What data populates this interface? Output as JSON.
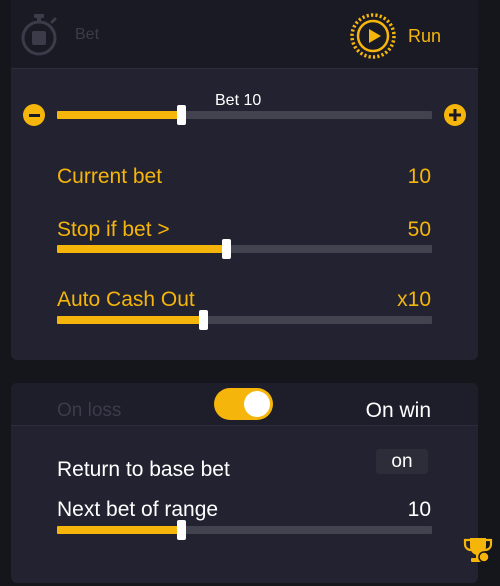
{
  "header": {
    "bet_tab_label": "Bet",
    "run_tab_label": "Run"
  },
  "bet_slider": {
    "label": "Bet 10",
    "value_fraction": 0.33
  },
  "current_bet": {
    "label": "Current bet",
    "value": "10"
  },
  "stop_if_bet": {
    "label": "Stop if bet >",
    "value": "50",
    "value_fraction": 0.45
  },
  "auto_cash_out": {
    "label": "Auto Cash Out",
    "value": "x10",
    "value_fraction": 0.39
  },
  "mode_toggle": {
    "left_label": "On loss",
    "right_label": "On win",
    "state": "on win"
  },
  "return_to_base": {
    "label": "Return to base bet",
    "value": "on"
  },
  "next_bet_range": {
    "label": "Next bet of range",
    "value": "10",
    "value_fraction": 0.33
  },
  "colors": {
    "accent": "#f5b50b",
    "panel": "#222230",
    "background": "#15151c",
    "track": "#43434f"
  },
  "icons": [
    "stopwatch-icon",
    "play-icon",
    "minus-icon",
    "plus-icon",
    "trophy-icon"
  ]
}
